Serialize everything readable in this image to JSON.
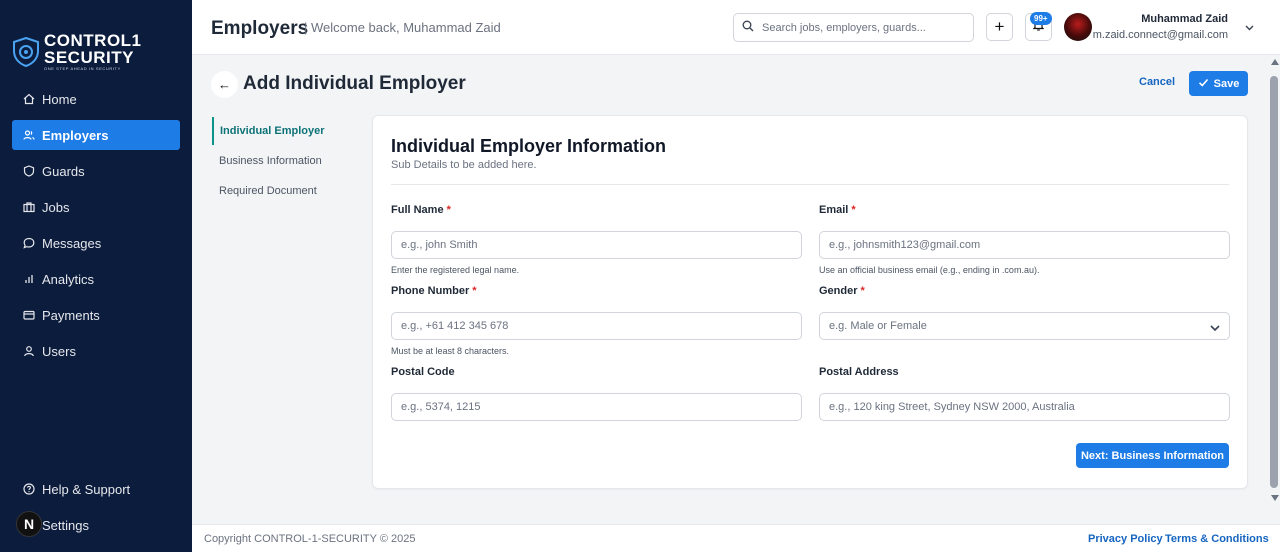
{
  "brand": {
    "line1": "CONTROL1",
    "line2": "SECURITY",
    "tagline": "ONE STEP AHEAD IN SECURITY"
  },
  "sidebar": {
    "items": [
      {
        "label": "Home",
        "icon": "home-icon"
      },
      {
        "label": "Employers",
        "icon": "users-icon",
        "active": true
      },
      {
        "label": "Guards",
        "icon": "shield-icon"
      },
      {
        "label": "Jobs",
        "icon": "briefcase-icon"
      },
      {
        "label": "Messages",
        "icon": "message-icon"
      },
      {
        "label": "Analytics",
        "icon": "bar-chart-icon"
      },
      {
        "label": "Payments",
        "icon": "credit-card-icon"
      },
      {
        "label": "Users",
        "icon": "user-icon"
      }
    ],
    "bottom": [
      {
        "label": "Help & Support",
        "icon": "help-circle-icon"
      },
      {
        "label": "Settings",
        "icon": "gear-icon"
      }
    ],
    "next_badge": "N"
  },
  "header": {
    "title": "Employers",
    "welcome": "| Welcome back, Muhammad Zaid",
    "search_placeholder": "Search jobs, employers, guards...",
    "plus": "+",
    "notif_count": "99+",
    "user_name": "Muhammad Zaid",
    "user_email": "m.zaid.connect@gmail.com"
  },
  "page": {
    "title": "Add Individual Employer",
    "back": "←",
    "cancel": "Cancel",
    "save": "Save"
  },
  "steps": [
    {
      "label": "Individual Employer",
      "active": true
    },
    {
      "label": "Business Information"
    },
    {
      "label": "Required Document"
    }
  ],
  "form": {
    "title": "Individual Employer Information",
    "subtitle": "Sub Details to be added here.",
    "full_name": {
      "label": "Full Name",
      "required": "*",
      "placeholder": "e.g., john Smith",
      "help": "Enter the registered legal name."
    },
    "email": {
      "label": "Email",
      "required": "*",
      "placeholder": "e.g., johnsmith123@gmail.com",
      "help": "Use an official business email (e.g., ending in .com.au)."
    },
    "phone": {
      "label": "Phone Number",
      "required": "*",
      "placeholder": "e.g., +61 412 345 678",
      "help": "Must be at least 8 characters."
    },
    "gender": {
      "label": "Gender",
      "required": "*",
      "placeholder": "e.g. Male or Female"
    },
    "postal_code": {
      "label": "Postal Code",
      "placeholder": "e.g., 5374, 1215"
    },
    "postal_address": {
      "label": "Postal Address",
      "placeholder": "e.g., 120 king Street, Sydney NSW 2000, Australia"
    },
    "next_button": "Next: Business Information"
  },
  "footer": {
    "copyright": "Copyright CONTROL-1-SECURITY © 2025",
    "privacy": "Privacy Policy",
    "terms": "Terms & Conditions"
  },
  "colors": {
    "sidebar_bg": "#0c1c3d",
    "accent": "#1e7ce6",
    "link": "#1565c0",
    "step_active": "#0d7377",
    "required": "#dc2626"
  }
}
